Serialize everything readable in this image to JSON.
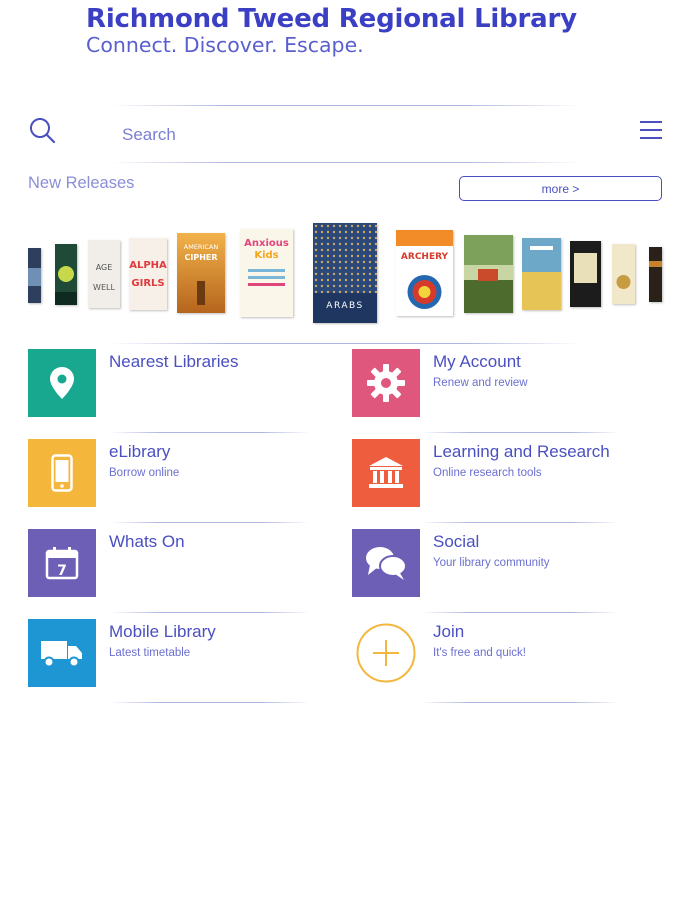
{
  "header": {
    "title": "Richmond Tweed Regional Library",
    "tagline": "Connect. Discover. Escape."
  },
  "search": {
    "placeholder": "Search",
    "icon": "search-icon",
    "menu_icon": "hamburger-menu-icon"
  },
  "new_releases": {
    "label": "New Releases",
    "more_label": "more >",
    "books": [
      {
        "name": "book-cover-1"
      },
      {
        "name": "book-cover-2"
      },
      {
        "name": "book-cover-age-well",
        "text": "AGE WELL"
      },
      {
        "name": "book-cover-alpha-girls",
        "text": "ALPHA GIRLS"
      },
      {
        "name": "book-cover-american-cipher",
        "text": "AMERICAN CIPHER"
      },
      {
        "name": "book-cover-anxious-kids",
        "text": "Anxious Kids"
      },
      {
        "name": "book-cover-arabs",
        "text": "ARABS"
      },
      {
        "name": "book-cover-archery-for-beginners",
        "text": "ARCHERY FOR BEGINNERS"
      },
      {
        "name": "book-cover-9"
      },
      {
        "name": "book-cover-10"
      },
      {
        "name": "book-cover-11"
      },
      {
        "name": "book-cover-12"
      },
      {
        "name": "book-cover-13"
      }
    ]
  },
  "tiles": [
    {
      "title": "Nearest Libraries",
      "subtitle": "",
      "icon": "map-pin-icon",
      "color": "#18a88f"
    },
    {
      "title": "My Account",
      "subtitle": "Renew and review",
      "icon": "gear-icon",
      "color": "#e0577e"
    },
    {
      "title": "eLibrary",
      "subtitle": "Borrow online",
      "icon": "mobile-phone-icon",
      "color": "#f4b63b"
    },
    {
      "title": "Learning and Research",
      "subtitle": "Online research tools",
      "icon": "institution-icon",
      "color": "#ef5d3f"
    },
    {
      "title": "Whats On",
      "subtitle": "",
      "icon": "calendar-icon",
      "color": "#6e5fb6",
      "calendar_day": "7"
    },
    {
      "title": "Social",
      "subtitle": "Your library community",
      "icon": "chat-bubbles-icon",
      "color": "#6e5fb6"
    },
    {
      "title": "Mobile Library",
      "subtitle": "Latest timetable",
      "icon": "truck-icon",
      "color": "#1e96d3"
    },
    {
      "title": "Join",
      "subtitle": "It's free and quick!",
      "icon": "plus-circle-icon",
      "color": "#f4b63b"
    }
  ]
}
